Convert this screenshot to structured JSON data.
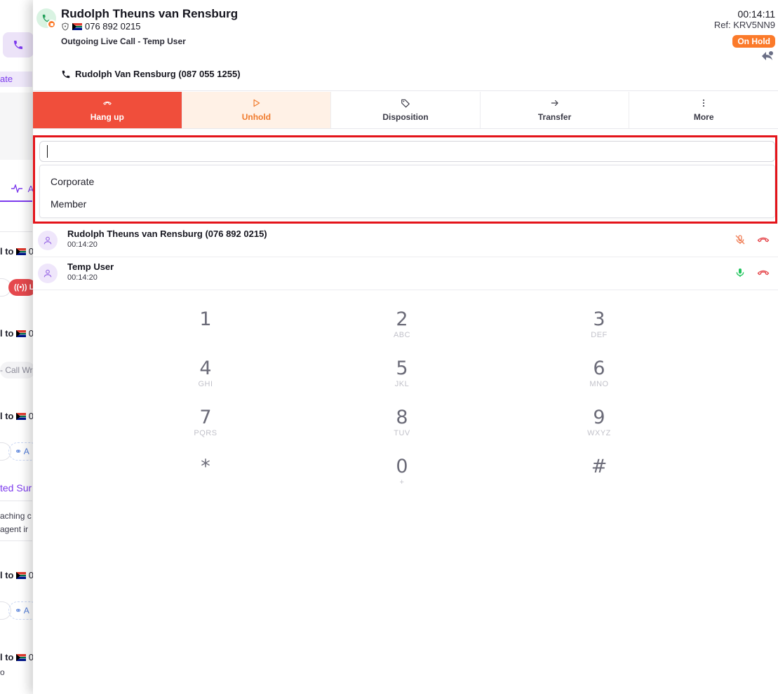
{
  "background": {
    "tag_text": "ate",
    "activity_text": "A",
    "call_rows": [
      {
        "prefix": "l to",
        "suffix": "0"
      },
      {
        "prefix": "l to",
        "suffix": "0"
      },
      {
        "prefix": "l to",
        "suffix": "0"
      },
      {
        "prefix": "l to",
        "suffix": "0"
      },
      {
        "prefix": "l to",
        "suffix": "0"
      }
    ],
    "live_badge": "L",
    "wrap_pill": "- Call Wr",
    "link_label": "A",
    "summary_title": "ted Sur",
    "summary_lines": [
      "aching c",
      "agent ir"
    ],
    "trailing_text": "o"
  },
  "call": {
    "caller_name": "Rudolph Theuns van Rensburg",
    "caller_number": "076 892 0215",
    "description": "Outgoing Live Call - Temp User",
    "line_label": "Rudolph Van Rensburg (087 055 1255)",
    "timer": "00:14:11",
    "ref": "Ref: KRV5NN9",
    "status": "On Hold"
  },
  "actions": {
    "hangup": "Hang up",
    "unhold": "Unhold",
    "disposition": "Disposition",
    "transfer": "Transfer",
    "more": "More"
  },
  "disposition_dropdown": {
    "search_value": "",
    "options": [
      "Corporate",
      "Member"
    ]
  },
  "participants": [
    {
      "name": "Rudolph Theuns van Rensburg (076 892 0215)",
      "duration": "00:14:20",
      "muted": true
    },
    {
      "name": "Temp User",
      "duration": "00:14:20",
      "muted": false
    }
  ],
  "keypad": [
    {
      "digit": "1",
      "letters": ""
    },
    {
      "digit": "2",
      "letters": "ABC"
    },
    {
      "digit": "3",
      "letters": "DEF"
    },
    {
      "digit": "4",
      "letters": "GHI"
    },
    {
      "digit": "5",
      "letters": "JKL"
    },
    {
      "digit": "6",
      "letters": "MNO"
    },
    {
      "digit": "7",
      "letters": "PQRS"
    },
    {
      "digit": "8",
      "letters": "TUV"
    },
    {
      "digit": "9",
      "letters": "WXYZ"
    },
    {
      "digit": "*",
      "letters": ""
    },
    {
      "digit": "0",
      "letters": "+"
    },
    {
      "digit": "#",
      "letters": ""
    }
  ],
  "colors": {
    "hangup": "#f04e3b",
    "unhold_bg": "#fff1e6",
    "unhold_text": "#f07a2c",
    "on_hold": "#fb7a2a",
    "accent": "#7c3aed",
    "highlight_frame": "#e4141a",
    "mic_active": "#22c55e",
    "mic_muted": "#f0815a"
  },
  "icons": {
    "call_status": "phone-icon",
    "shield": "shield-icon",
    "flag": "za-flag-icon",
    "line": "phone-icon",
    "reply": "reply-icon",
    "hangup": "phone-hangup-icon",
    "unhold": "play-icon",
    "disposition": "tag-icon",
    "transfer": "arrow-right-icon",
    "more": "more-vertical-icon",
    "participant": "user-icon",
    "mic": "mic-icon",
    "mic_off": "mic-off-icon"
  }
}
